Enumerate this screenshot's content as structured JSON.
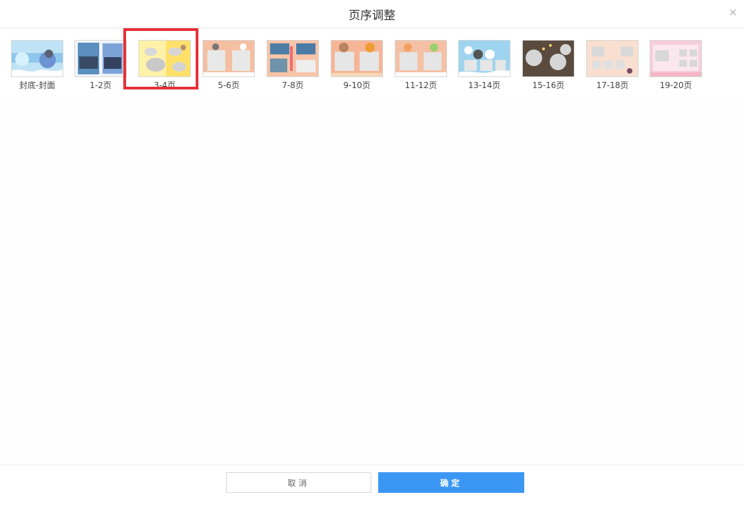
{
  "dialog": {
    "title": "页序调整",
    "close_symbol": "×"
  },
  "pages": [
    {
      "label": "封底-封面",
      "theme": "cover"
    },
    {
      "label": "1-2页",
      "theme": "photo"
    },
    {
      "label": "3-4页",
      "theme": "yellow"
    },
    {
      "label": "5-6页",
      "theme": "peach"
    },
    {
      "label": "7-8页",
      "theme": "photo-orange"
    },
    {
      "label": "9-10页",
      "theme": "bear"
    },
    {
      "label": "11-12页",
      "theme": "frog"
    },
    {
      "label": "13-14页",
      "theme": "blue"
    },
    {
      "label": "15-16页",
      "theme": "dark"
    },
    {
      "label": "17-18页",
      "theme": "cream"
    },
    {
      "label": "19-20页",
      "theme": "pink"
    }
  ],
  "selected_page": "3-4页",
  "footer": {
    "cancel_label": "取消",
    "ok_label": "确定"
  },
  "colors": {
    "accent": "#3c97f4",
    "highlight": "#e43137"
  }
}
